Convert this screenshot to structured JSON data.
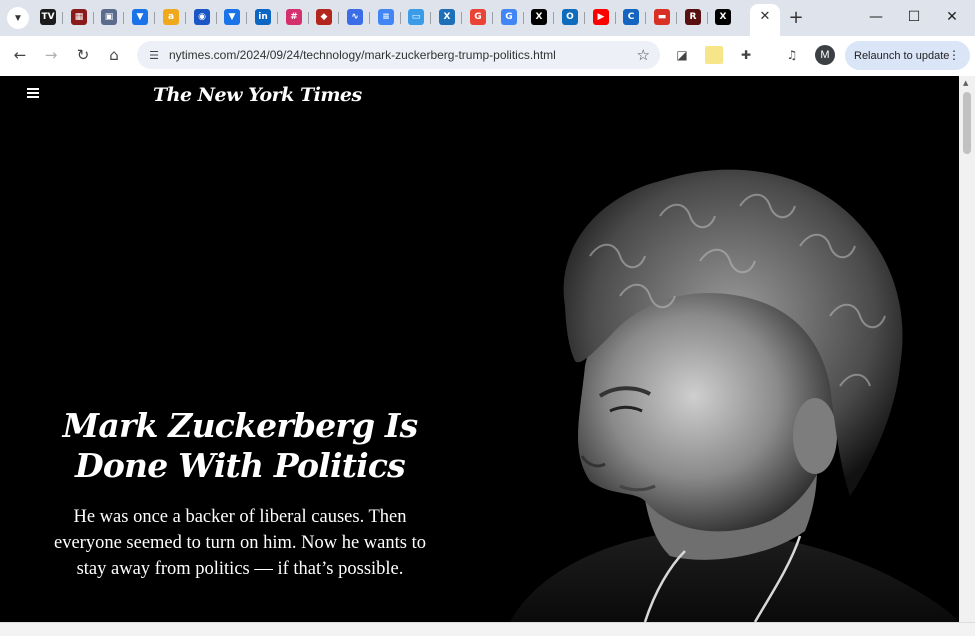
{
  "browser": {
    "tabs": [
      {
        "icon": "tab-list-icon"
      },
      {
        "icon": "tv-favicon-icon",
        "glyph": "TV",
        "color": "#1b1b1b"
      },
      {
        "icon": "film-favicon-icon",
        "glyph": "▦",
        "color": "#8b1a1a"
      },
      {
        "icon": "grid-favicon-icon",
        "glyph": "▣",
        "color": "#5b6b8c"
      },
      {
        "icon": "pocket-favicon-icon",
        "glyph": "▼",
        "color": "#1a73e8"
      },
      {
        "icon": "amazon-favicon-icon",
        "glyph": "a",
        "color": "#f0a81c"
      },
      {
        "icon": "cbs-favicon-icon",
        "glyph": "◉",
        "color": "#1a56c4"
      },
      {
        "icon": "pocket-favicon-icon",
        "glyph": "▼",
        "color": "#1a73e8"
      },
      {
        "icon": "linkedin-favicon-icon",
        "glyph": "in",
        "color": "#0a66c2"
      },
      {
        "icon": "slack-favicon-icon",
        "glyph": "#",
        "color": "#d4306e"
      },
      {
        "icon": "shield-favicon-icon",
        "glyph": "◆",
        "color": "#b3261e"
      },
      {
        "icon": "wave-favicon-icon",
        "glyph": "∿",
        "color": "#3b6ee6"
      },
      {
        "icon": "docs-favicon-icon",
        "glyph": "≡",
        "color": "#4285f4"
      },
      {
        "icon": "calendar-favicon-icon",
        "glyph": "▭",
        "color": "#3b9be6"
      },
      {
        "icon": "x-circle-favicon-icon",
        "glyph": "X",
        "color": "#1d6fb8"
      },
      {
        "icon": "google-favicon-icon",
        "glyph": "G",
        "color": "#ea4335"
      },
      {
        "icon": "google-favicon-icon",
        "glyph": "G",
        "color": "#4285f4"
      },
      {
        "icon": "x-favicon-icon",
        "glyph": "X",
        "color": "#000000"
      },
      {
        "icon": "outlook-favicon-icon",
        "glyph": "O",
        "color": "#0f6cbd"
      },
      {
        "icon": "youtube-favicon-icon",
        "glyph": "▶",
        "color": "#ff0000"
      },
      {
        "icon": "c-favicon-icon",
        "glyph": "C",
        "color": "#1565c0"
      },
      {
        "icon": "news-favicon-icon",
        "glyph": "▬",
        "color": "#d93025"
      },
      {
        "icon": "red-dark-favicon-icon",
        "glyph": "R",
        "color": "#5a1010"
      },
      {
        "icon": "x-favicon-icon",
        "glyph": "X",
        "color": "#000000"
      }
    ],
    "url": "nytimes.com/2024/09/24/technology/mark-zuckerberg-trump-politics.html",
    "profile_initial": "M",
    "relaunch_label": "Relaunch to update"
  },
  "article": {
    "masthead": "The New York Times",
    "headline_line1": "Mark Zuckerberg Is",
    "headline_line2": "Done With Politics",
    "dek_line1": "He was once a backer of liberal causes. Then",
    "dek_line2": "everyone seemed to turn on him. Now he wants to",
    "dek_line3": "stay away from politics — if that’s possible.",
    "hero_image": "black-and-white-portrait-photo"
  }
}
